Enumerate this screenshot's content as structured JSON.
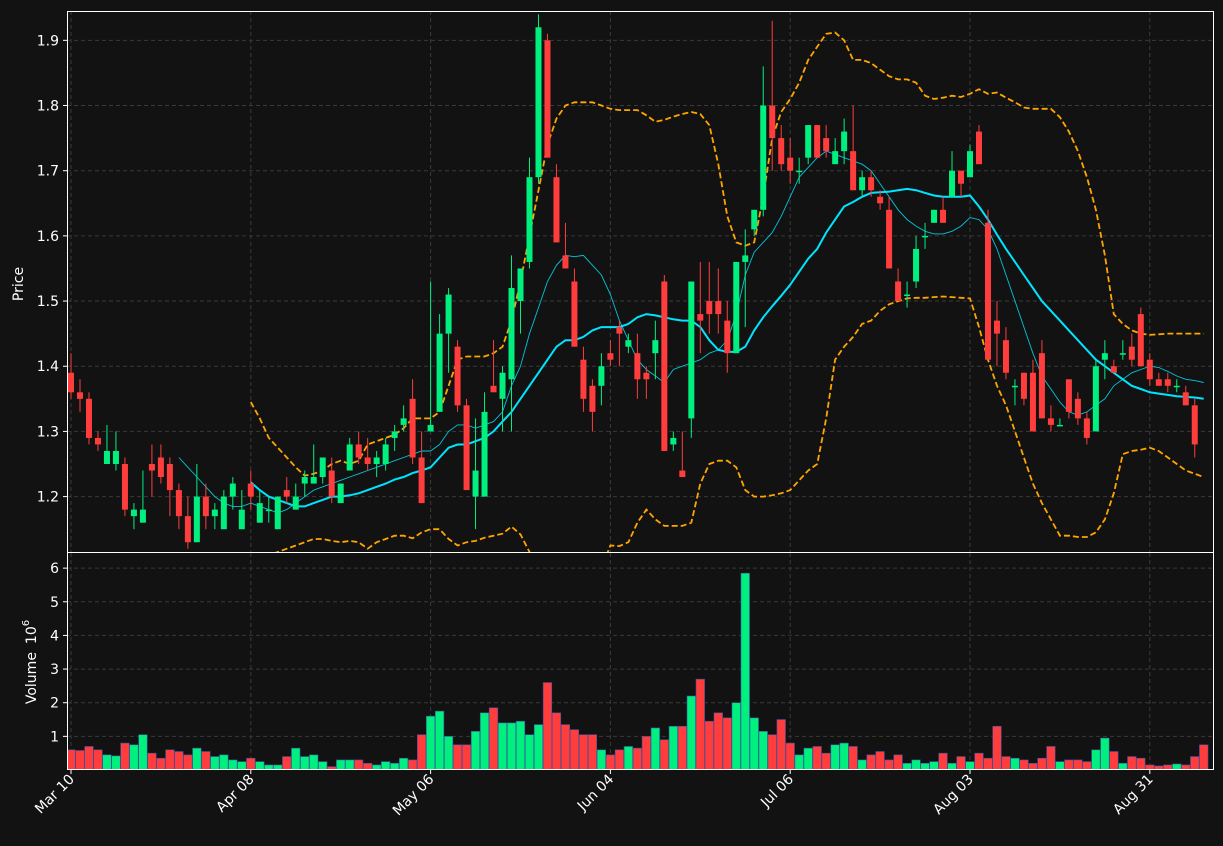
{
  "chart_data": {
    "type": "candlestick",
    "style": {
      "background": "#121212",
      "up_color": "#00f07f",
      "down_color": "#ff3d3d",
      "grid_color": "#3a3a3a",
      "ma_color": "#00e5ff",
      "band_color": "#ffa500"
    },
    "price_panel": {
      "ylabel": "Price",
      "ylim": [
        1.115,
        1.945
      ],
      "yticks": [
        "1.2",
        "1.3",
        "1.4",
        "1.5",
        "1.6",
        "1.7",
        "1.8",
        "1.9"
      ]
    },
    "volume_panel": {
      "ylabel": "Volume",
      "ylabel_exponent": "6",
      "ylim": [
        0,
        6.45
      ],
      "yticks": [
        "1",
        "2",
        "3",
        "4",
        "5",
        "6"
      ]
    },
    "xticks": [
      {
        "label": "Mar 10",
        "index": 0
      },
      {
        "label": "Apr 08",
        "index": 20
      },
      {
        "label": "May 06",
        "index": 40
      },
      {
        "label": "Jun 04",
        "index": 60
      },
      {
        "label": "Jul 06",
        "index": 80
      },
      {
        "label": "Aug 03",
        "index": 100
      },
      {
        "label": "Aug 31",
        "index": 120
      }
    ],
    "ohlc": [
      [
        1.39,
        1.42,
        1.35,
        1.36
      ],
      [
        1.36,
        1.38,
        1.33,
        1.35
      ],
      [
        1.35,
        1.36,
        1.28,
        1.29
      ],
      [
        1.29,
        1.3,
        1.27,
        1.28
      ],
      [
        1.25,
        1.31,
        1.25,
        1.27
      ],
      [
        1.25,
        1.3,
        1.24,
        1.27
      ],
      [
        1.25,
        1.26,
        1.17,
        1.18
      ],
      [
        1.17,
        1.19,
        1.15,
        1.18
      ],
      [
        1.16,
        1.24,
        1.16,
        1.18
      ],
      [
        1.25,
        1.28,
        1.2,
        1.24
      ],
      [
        1.26,
        1.28,
        1.22,
        1.23
      ],
      [
        1.25,
        1.26,
        1.17,
        1.21
      ],
      [
        1.21,
        1.22,
        1.15,
        1.17
      ],
      [
        1.17,
        1.2,
        1.12,
        1.13
      ],
      [
        1.13,
        1.25,
        1.13,
        1.2
      ],
      [
        1.2,
        1.22,
        1.15,
        1.17
      ],
      [
        1.17,
        1.19,
        1.15,
        1.18
      ],
      [
        1.15,
        1.21,
        1.15,
        1.2
      ],
      [
        1.2,
        1.23,
        1.18,
        1.22
      ],
      [
        1.15,
        1.21,
        1.15,
        1.18
      ],
      [
        1.22,
        1.24,
        1.18,
        1.2
      ],
      [
        1.16,
        1.21,
        1.16,
        1.19
      ],
      [
        1.18,
        1.2,
        1.16,
        1.18
      ],
      [
        1.15,
        1.2,
        1.15,
        1.2
      ],
      [
        1.21,
        1.23,
        1.19,
        1.2
      ],
      [
        1.18,
        1.22,
        1.18,
        1.2
      ],
      [
        1.22,
        1.24,
        1.2,
        1.23
      ],
      [
        1.22,
        1.28,
        1.22,
        1.23
      ],
      [
        1.23,
        1.26,
        1.22,
        1.26
      ],
      [
        1.24,
        1.26,
        1.19,
        1.2
      ],
      [
        1.19,
        1.22,
        1.19,
        1.22
      ],
      [
        1.24,
        1.29,
        1.24,
        1.28
      ],
      [
        1.28,
        1.3,
        1.25,
        1.26
      ],
      [
        1.26,
        1.29,
        1.24,
        1.25
      ],
      [
        1.25,
        1.27,
        1.23,
        1.26
      ],
      [
        1.25,
        1.29,
        1.24,
        1.28
      ],
      [
        1.29,
        1.31,
        1.27,
        1.3
      ],
      [
        1.31,
        1.34,
        1.3,
        1.32
      ],
      [
        1.35,
        1.38,
        1.25,
        1.26
      ],
      [
        1.26,
        1.3,
        1.19,
        1.19
      ],
      [
        1.3,
        1.53,
        1.3,
        1.31
      ],
      [
        1.33,
        1.48,
        1.33,
        1.45
      ],
      [
        1.45,
        1.52,
        1.39,
        1.51
      ],
      [
        1.43,
        1.44,
        1.33,
        1.34
      ],
      [
        1.34,
        1.35,
        1.21,
        1.21
      ],
      [
        1.2,
        1.32,
        1.15,
        1.24
      ],
      [
        1.2,
        1.36,
        1.2,
        1.33
      ],
      [
        1.37,
        1.44,
        1.37,
        1.36
      ],
      [
        1.35,
        1.4,
        1.3,
        1.39
      ],
      [
        1.38,
        1.57,
        1.3,
        1.52
      ],
      [
        1.5,
        1.55,
        1.45,
        1.55
      ],
      [
        1.56,
        1.72,
        1.55,
        1.69
      ],
      [
        1.69,
        1.94,
        1.68,
        1.92
      ],
      [
        1.9,
        1.91,
        1.72,
        1.72
      ],
      [
        1.69,
        1.71,
        1.59,
        1.59
      ],
      [
        1.57,
        1.62,
        1.55,
        1.55
      ],
      [
        1.53,
        1.55,
        1.43,
        1.43
      ],
      [
        1.41,
        1.43,
        1.33,
        1.35
      ],
      [
        1.37,
        1.38,
        1.3,
        1.33
      ],
      [
        1.37,
        1.42,
        1.34,
        1.4
      ],
      [
        1.42,
        1.44,
        1.4,
        1.41
      ],
      [
        1.46,
        1.47,
        1.4,
        1.45
      ],
      [
        1.43,
        1.45,
        1.42,
        1.44
      ],
      [
        1.42,
        1.45,
        1.35,
        1.38
      ],
      [
        1.39,
        1.4,
        1.35,
        1.38
      ],
      [
        1.42,
        1.47,
        1.38,
        1.44
      ],
      [
        1.53,
        1.54,
        1.27,
        1.27
      ],
      [
        1.28,
        1.3,
        1.27,
        1.29
      ],
      [
        1.24,
        1.3,
        1.23,
        1.23
      ],
      [
        1.32,
        1.53,
        1.29,
        1.53
      ],
      [
        1.48,
        1.56,
        1.42,
        1.47
      ],
      [
        1.5,
        1.56,
        1.45,
        1.48
      ],
      [
        1.5,
        1.55,
        1.45,
        1.48
      ],
      [
        1.47,
        1.5,
        1.39,
        1.42
      ],
      [
        1.42,
        1.56,
        1.42,
        1.56
      ],
      [
        1.56,
        1.61,
        1.46,
        1.57
      ],
      [
        1.61,
        1.64,
        1.6,
        1.64
      ],
      [
        1.64,
        1.86,
        1.63,
        1.8
      ],
      [
        1.8,
        1.93,
        1.7,
        1.75
      ],
      [
        1.75,
        1.77,
        1.7,
        1.71
      ],
      [
        1.72,
        1.75,
        1.68,
        1.7
      ],
      [
        1.7,
        1.72,
        1.68,
        1.7
      ],
      [
        1.72,
        1.77,
        1.71,
        1.77
      ],
      [
        1.77,
        1.77,
        1.72,
        1.72
      ],
      [
        1.75,
        1.77,
        1.72,
        1.73
      ],
      [
        1.71,
        1.75,
        1.71,
        1.73
      ],
      [
        1.73,
        1.78,
        1.71,
        1.76
      ],
      [
        1.73,
        1.8,
        1.67,
        1.67
      ],
      [
        1.67,
        1.7,
        1.66,
        1.69
      ],
      [
        1.69,
        1.7,
        1.66,
        1.67
      ],
      [
        1.66,
        1.67,
        1.64,
        1.65
      ],
      [
        1.64,
        1.66,
        1.55,
        1.55
      ],
      [
        1.53,
        1.55,
        1.5,
        1.5
      ],
      [
        1.51,
        1.53,
        1.49,
        1.51
      ],
      [
        1.53,
        1.6,
        1.52,
        1.58
      ],
      [
        1.6,
        1.62,
        1.58,
        1.6
      ],
      [
        1.62,
        1.64,
        1.62,
        1.64
      ],
      [
        1.64,
        1.66,
        1.62,
        1.62
      ],
      [
        1.66,
        1.73,
        1.66,
        1.7
      ],
      [
        1.7,
        1.7,
        1.66,
        1.68
      ],
      [
        1.69,
        1.74,
        1.69,
        1.73
      ],
      [
        1.76,
        1.77,
        1.73,
        1.71
      ],
      [
        1.62,
        1.64,
        1.42,
        1.41
      ],
      [
        1.47,
        1.5,
        1.4,
        1.45
      ],
      [
        1.44,
        1.46,
        1.38,
        1.39
      ],
      [
        1.37,
        1.38,
        1.34,
        1.37
      ],
      [
        1.39,
        1.39,
        1.34,
        1.35
      ],
      [
        1.39,
        1.41,
        1.3,
        1.3
      ],
      [
        1.42,
        1.44,
        1.32,
        1.32
      ],
      [
        1.32,
        1.34,
        1.3,
        1.31
      ],
      [
        1.31,
        1.32,
        1.31,
        1.31
      ],
      [
        1.38,
        1.38,
        1.32,
        1.33
      ],
      [
        1.35,
        1.36,
        1.31,
        1.32
      ],
      [
        1.32,
        1.33,
        1.28,
        1.29
      ],
      [
        1.3,
        1.41,
        1.3,
        1.4
      ],
      [
        1.41,
        1.44,
        1.38,
        1.42
      ],
      [
        1.4,
        1.41,
        1.39,
        1.39
      ],
      [
        1.42,
        1.44,
        1.41,
        1.42
      ],
      [
        1.43,
        1.45,
        1.4,
        1.41
      ],
      [
        1.48,
        1.49,
        1.4,
        1.4
      ],
      [
        1.41,
        1.42,
        1.37,
        1.38
      ],
      [
        1.38,
        1.39,
        1.37,
        1.37
      ],
      [
        1.38,
        1.39,
        1.36,
        1.37
      ],
      [
        1.37,
        1.38,
        1.36,
        1.37
      ],
      [
        1.36,
        1.37,
        1.34,
        1.34
      ],
      [
        1.34,
        1.35,
        1.26,
        1.28
      ]
    ],
    "volume": [
      0.6,
      0.58,
      0.7,
      0.6,
      0.45,
      0.42,
      0.8,
      0.75,
      1.05,
      0.5,
      0.35,
      0.6,
      0.55,
      0.45,
      0.65,
      0.55,
      0.4,
      0.45,
      0.3,
      0.25,
      0.35,
      0.25,
      0.15,
      0.15,
      0.4,
      0.65,
      0.4,
      0.45,
      0.25,
      0.1,
      0.3,
      0.3,
      0.3,
      0.2,
      0.15,
      0.25,
      0.2,
      0.35,
      0.3,
      1.05,
      1.6,
      1.75,
      1.0,
      0.75,
      0.75,
      1.15,
      1.7,
      1.85,
      1.4,
      1.4,
      1.45,
      1.05,
      1.35,
      2.6,
      1.7,
      1.35,
      1.2,
      1.05,
      1.05,
      0.6,
      0.45,
      0.6,
      0.7,
      0.65,
      1.0,
      1.25,
      0.9,
      1.3,
      1.3,
      2.2,
      2.7,
      1.45,
      1.7,
      1.55,
      2.0,
      5.85,
      1.55,
      1.15,
      1.05,
      1.5,
      0.8,
      0.45,
      0.65,
      0.7,
      0.5,
      0.75,
      0.8,
      0.7,
      0.3,
      0.45,
      0.55,
      0.3,
      0.45,
      0.2,
      0.3,
      0.2,
      0.25,
      0.5,
      0.2,
      0.4,
      0.25,
      0.5,
      0.35,
      1.3,
      0.4,
      0.35,
      0.3,
      0.2,
      0.35,
      0.7,
      0.25,
      0.3,
      0.3,
      0.25,
      0.6,
      0.95,
      0.55,
      0.2,
      0.4,
      0.35,
      0.15,
      0.12,
      0.15,
      0.18,
      0.15,
      0.4,
      0.75
    ],
    "ma_fast": [
      null,
      null,
      null,
      null,
      null,
      null,
      null,
      null,
      null,
      null,
      null,
      null,
      1.26,
      1.245,
      1.23,
      1.215,
      1.2,
      1.19,
      1.185,
      1.185,
      1.19,
      1.185,
      1.18,
      1.175,
      1.18,
      1.19,
      1.2,
      1.21,
      1.215,
      1.22,
      1.225,
      1.23,
      1.235,
      1.24,
      1.245,
      1.25,
      1.255,
      1.26,
      1.265,
      1.27,
      1.27,
      1.28,
      1.3,
      1.31,
      1.31,
      1.305,
      1.31,
      1.315,
      1.33,
      1.37,
      1.4,
      1.45,
      1.49,
      1.53,
      1.555,
      1.57,
      1.568,
      1.57,
      1.555,
      1.54,
      1.51,
      1.47,
      1.44,
      1.41,
      1.395,
      1.385,
      1.375,
      1.395,
      1.4,
      1.405,
      1.41,
      1.42,
      1.425,
      1.44,
      1.48,
      1.54,
      1.575,
      1.59,
      1.605,
      1.63,
      1.66,
      1.69,
      1.705,
      1.72,
      1.73,
      1.725,
      1.72,
      1.715,
      1.71,
      1.7,
      1.68,
      1.66,
      1.64,
      1.625,
      1.615,
      1.607,
      1.603,
      1.603,
      1.607,
      1.615,
      1.628,
      1.625,
      1.61,
      1.58,
      1.54,
      1.5,
      1.46,
      1.42,
      1.385,
      1.365,
      1.345,
      1.33,
      1.325,
      1.33,
      1.34,
      1.35,
      1.37,
      1.38,
      1.39,
      1.395,
      1.4,
      1.398,
      1.392,
      1.385,
      1.38,
      1.378,
      1.375
    ],
    "ma_slow": [
      null,
      null,
      null,
      null,
      null,
      null,
      null,
      null,
      null,
      null,
      null,
      null,
      null,
      null,
      null,
      null,
      null,
      null,
      null,
      null,
      1.222,
      1.21,
      1.2,
      1.195,
      1.19,
      1.185,
      1.185,
      1.19,
      1.195,
      1.2,
      1.2,
      1.202,
      1.205,
      1.21,
      1.215,
      1.22,
      1.226,
      1.23,
      1.236,
      1.24,
      1.245,
      1.26,
      1.275,
      1.28,
      1.28,
      1.285,
      1.29,
      1.3,
      1.315,
      1.33,
      1.35,
      1.37,
      1.39,
      1.41,
      1.43,
      1.44,
      1.44,
      1.445,
      1.455,
      1.46,
      1.46,
      1.46,
      1.465,
      1.475,
      1.48,
      1.478,
      1.475,
      1.472,
      1.47,
      1.47,
      1.46,
      1.44,
      1.425,
      1.422,
      1.422,
      1.43,
      1.455,
      1.475,
      1.492,
      1.508,
      1.525,
      1.545,
      1.565,
      1.58,
      1.605,
      1.625,
      1.645,
      1.652,
      1.66,
      1.666,
      1.667,
      1.668,
      1.67,
      1.672,
      1.67,
      1.666,
      1.662,
      1.66,
      1.66,
      1.66,
      1.662,
      1.645,
      1.625,
      1.602,
      1.58,
      1.56,
      1.54,
      1.52,
      1.5,
      1.485,
      1.47,
      1.455,
      1.44,
      1.425,
      1.41,
      1.4,
      1.39,
      1.38,
      1.37,
      1.365,
      1.36,
      1.358,
      1.356,
      1.354,
      1.353,
      1.352,
      1.35
    ],
    "band_upper": [
      null,
      null,
      null,
      null,
      null,
      null,
      null,
      null,
      null,
      null,
      null,
      null,
      null,
      null,
      null,
      null,
      null,
      null,
      null,
      null,
      1.345,
      1.32,
      1.29,
      1.275,
      1.26,
      1.245,
      1.232,
      1.235,
      1.24,
      1.25,
      1.255,
      1.25,
      1.255,
      1.28,
      1.285,
      1.29,
      1.295,
      1.305,
      1.32,
      1.32,
      1.32,
      1.33,
      1.37,
      1.41,
      1.415,
      1.415,
      1.415,
      1.42,
      1.43,
      1.47,
      1.53,
      1.6,
      1.67,
      1.74,
      1.78,
      1.8,
      1.805,
      1.805,
      1.805,
      1.8,
      1.795,
      1.793,
      1.793,
      1.793,
      1.785,
      1.775,
      1.778,
      1.783,
      1.787,
      1.79,
      1.787,
      1.77,
      1.71,
      1.63,
      1.59,
      1.585,
      1.59,
      1.66,
      1.75,
      1.79,
      1.81,
      1.835,
      1.87,
      1.89,
      1.91,
      1.912,
      1.9,
      1.87,
      1.87,
      1.865,
      1.855,
      1.845,
      1.84,
      1.84,
      1.835,
      1.815,
      1.81,
      1.812,
      1.815,
      1.813,
      1.818,
      1.825,
      1.818,
      1.82,
      1.812,
      1.805,
      1.797,
      1.795,
      1.795,
      1.795,
      1.782,
      1.76,
      1.73,
      1.69,
      1.64,
      1.57,
      1.48,
      1.465,
      1.455,
      1.45,
      1.448,
      1.449,
      1.45,
      1.45,
      1.45,
      1.45,
      1.45
    ],
    "band_lower": [
      null,
      null,
      null,
      null,
      null,
      null,
      null,
      null,
      null,
      null,
      null,
      null,
      null,
      null,
      null,
      null,
      null,
      null,
      null,
      null,
      1.09,
      1.1,
      1.11,
      1.115,
      1.12,
      1.125,
      1.13,
      1.135,
      1.135,
      1.132,
      1.13,
      1.132,
      1.13,
      1.12,
      1.13,
      1.135,
      1.14,
      1.14,
      1.136,
      1.145,
      1.15,
      1.15,
      1.135,
      1.125,
      1.13,
      1.132,
      1.137,
      1.14,
      1.143,
      1.154,
      1.142,
      1.115,
      1.06,
      1.02,
      0.98,
      0.97,
      0.985,
      1.02,
      1.06,
      1.09,
      1.125,
      1.124,
      1.13,
      1.16,
      1.18,
      1.165,
      1.155,
      1.155,
      1.155,
      1.16,
      1.22,
      1.25,
      1.255,
      1.255,
      1.245,
      1.21,
      1.2,
      1.2,
      1.202,
      1.205,
      1.21,
      1.225,
      1.24,
      1.25,
      1.32,
      1.41,
      1.43,
      1.445,
      1.465,
      1.47,
      1.485,
      1.495,
      1.5,
      1.504,
      1.505,
      1.505,
      1.506,
      1.507,
      1.506,
      1.505,
      1.504,
      1.46,
      1.41,
      1.37,
      1.34,
      1.3,
      1.26,
      1.22,
      1.19,
      1.165,
      1.14,
      1.14,
      1.138,
      1.138,
      1.145,
      1.165,
      1.205,
      1.265,
      1.27,
      1.272,
      1.275,
      1.27,
      1.26,
      1.25,
      1.24,
      1.235,
      1.23
    ]
  }
}
